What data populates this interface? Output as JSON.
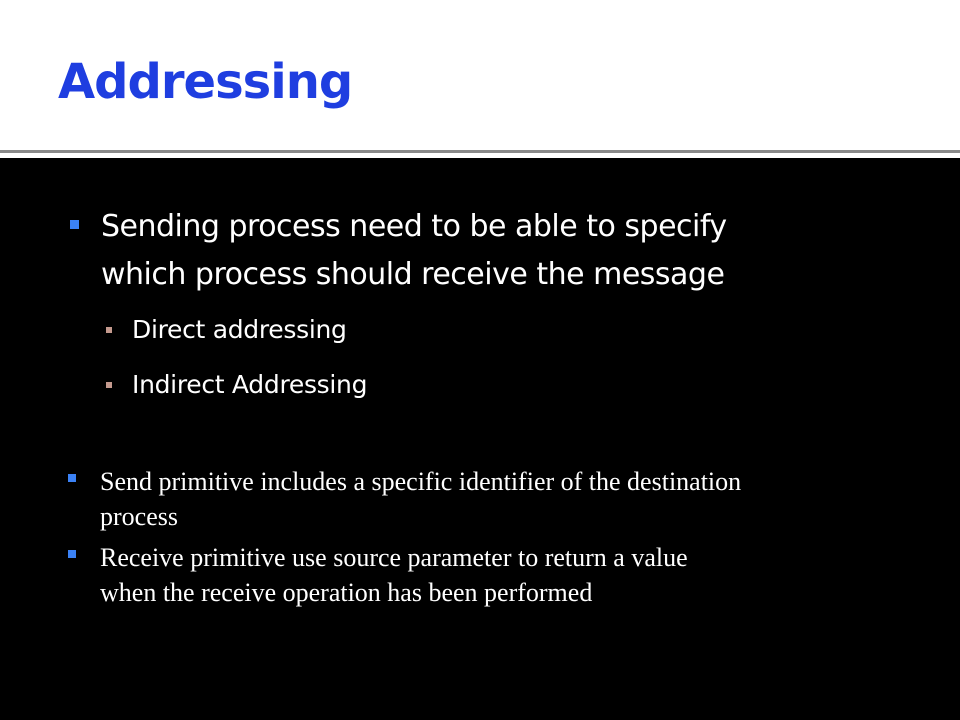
{
  "slide": {
    "title": "Addressing",
    "bullets": [
      {
        "lines": [
          "Sending process need to be able to specify",
          "which process should receive the message"
        ],
        "sub_items": [
          "Direct addressing",
          "Indirect Addressing"
        ]
      },
      {
        "lines": [
          "Send primitive includes a specific identifier of the destination",
          "process"
        ]
      },
      {
        "lines": [
          "Receive primitive  use source parameter to return a value",
          "when the receive operation has been performed"
        ]
      }
    ]
  },
  "colors": {
    "title_text": "#1f3ee0",
    "background": "#000000",
    "header_background": "#ffffff",
    "body_text": "#ffffff",
    "main_bullet": "#3b82f6",
    "sub_bullet": "#c49a8e"
  }
}
